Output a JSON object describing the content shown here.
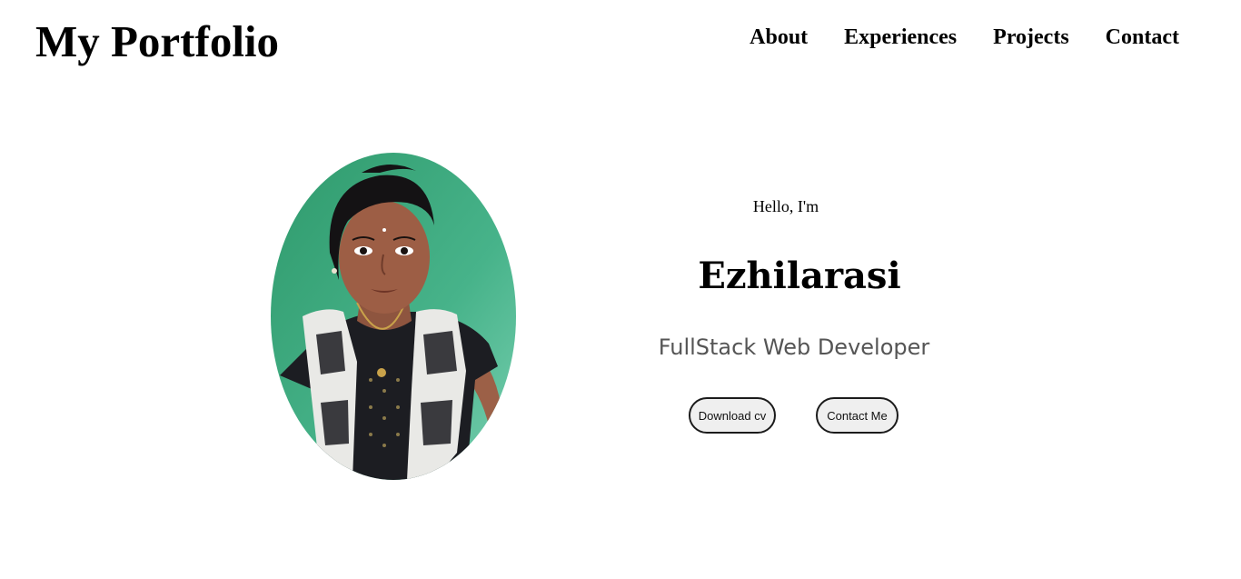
{
  "header": {
    "logo": "My Portfolio",
    "nav": [
      "About",
      "Experiences",
      "Projects",
      "Contact"
    ]
  },
  "hero": {
    "greeting": "Hello, I'm",
    "name": "Ezhilarasi",
    "role": "FullStack Web Developer",
    "buttons": {
      "download_cv": "Download cv",
      "contact_me": "Contact Me"
    }
  },
  "colors": {
    "background": "#ffffff",
    "text": "#000000",
    "role_text": "#555555",
    "button_bg": "#efefef",
    "button_border": "#1b1b1b"
  }
}
